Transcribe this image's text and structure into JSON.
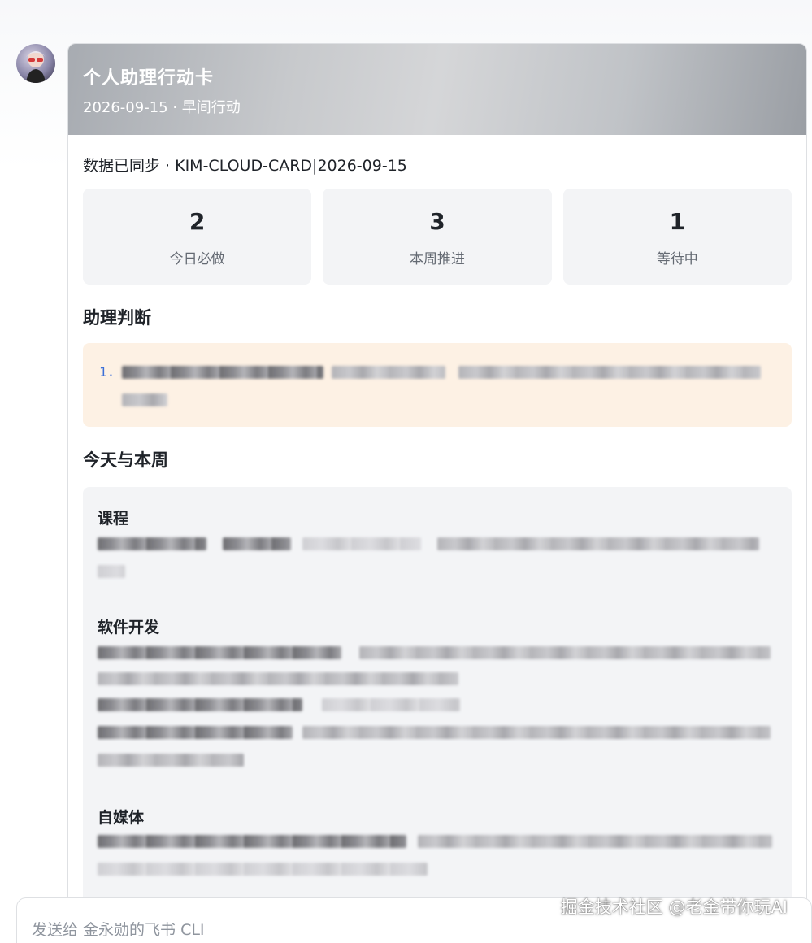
{
  "card": {
    "title": "个人助理行动卡",
    "subtitle": "2026-09-15 · 早间行动",
    "sync_line": "数据已同步 · KIM-CLOUD-CARD|2026-09-15",
    "stats": [
      {
        "value": "2",
        "label": "今日必做"
      },
      {
        "value": "3",
        "label": "本周推进"
      },
      {
        "value": "1",
        "label": "等待中"
      }
    ],
    "judgement": {
      "title": "助理判断",
      "item_number": "1."
    },
    "weekly": {
      "title": "今天与本周",
      "groups": [
        {
          "label": "课程"
        },
        {
          "label": "软件开发"
        },
        {
          "label": "自媒体"
        }
      ]
    }
  },
  "input": {
    "placeholder": "发送给 金永勋的飞书 CLI"
  },
  "watermark": "掘金技术社区 @老金带你玩AI",
  "colors": {
    "header_gradient": "#c7c9cc",
    "judgement_bg": "#fdf1e4",
    "panel_bg": "#f3f4f6",
    "list_number": "#3b6fd8"
  },
  "icons": {
    "avatar": "cartoon-avatar"
  }
}
